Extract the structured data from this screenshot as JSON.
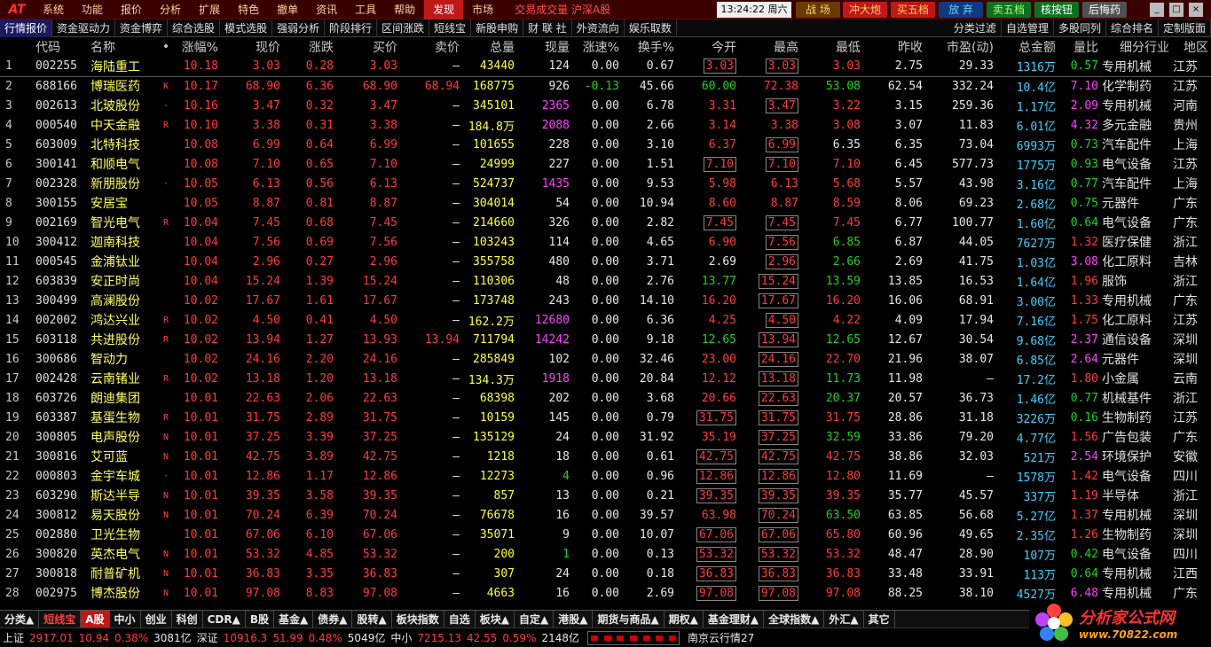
{
  "menubar": {
    "logo": "AT",
    "items": [
      "系统",
      "功能",
      "报价",
      "分析",
      "扩展",
      "特色",
      "撤单",
      "资讯",
      "工具",
      "帮助",
      "发现",
      "市场"
    ],
    "active_index": 10,
    "ticker": "交易成交量 沪深A股",
    "clock": "13:24:22 周六",
    "quick_buttons": [
      {
        "label": "战 场",
        "bg": "#6a3a00",
        "fg": "#ffd060"
      },
      {
        "label": "冲大炮",
        "bg": "#c01818",
        "fg": "#ffd060"
      },
      {
        "label": "买五档",
        "bg": "#c01818",
        "fg": "#ffd060"
      },
      {
        "label": "放 弃",
        "bg": "#103a80",
        "fg": "#60d0ff"
      },
      {
        "label": "卖五档",
        "bg": "#107020",
        "fg": "#a0ff80"
      },
      {
        "label": "核按钮",
        "bg": "#107020",
        "fg": "#ffffff"
      },
      {
        "label": "后悔药",
        "bg": "#505050",
        "fg": "#ffffff"
      }
    ],
    "window_buttons": [
      "_",
      "□",
      "×"
    ]
  },
  "subbar": {
    "items": [
      "行情报价",
      "资金驱动力",
      "资金博弈",
      "综合选股",
      "模式选股",
      "强弱分析",
      "阶段排行",
      "区间涨跌",
      "短线宝",
      "新股申购",
      "财 联 社",
      "外资流向",
      "娱乐取数"
    ],
    "active_index": 0,
    "right_items": [
      "分类过滤",
      "自选管理",
      "多股同列",
      "综合排名",
      "定制版面"
    ]
  },
  "table": {
    "columns": [
      "",
      "代码",
      "名称",
      "•",
      "涨幅%",
      "现价",
      "涨跌",
      "买价",
      "卖价",
      "总量",
      "现量",
      "涨速%",
      "换手%",
      "今开",
      "最高",
      "最低",
      "昨收",
      "市盈(动)",
      "总金额",
      "量比",
      "细分行业",
      "地区"
    ],
    "rows": [
      [
        "1",
        "002255",
        "海陆重工",
        "",
        "10.18",
        "3.03",
        "0.28",
        "3.03",
        "–",
        "43440",
        "124",
        "0.00",
        "0.67",
        "3.03",
        "3.03",
        "3.03",
        "2.75",
        "29.33",
        "1316万",
        "0.57",
        "专用机械",
        "江苏"
      ],
      [
        "2",
        "688166",
        "博瑞医药",
        "K",
        "10.17",
        "68.90",
        "6.36",
        "68.90",
        "68.94",
        "168775",
        "926",
        "-0.13",
        "45.66",
        "60.00",
        "72.38",
        "53.08",
        "62.54",
        "332.24",
        "10.4亿",
        "7.10",
        "化学制药",
        "江苏"
      ],
      [
        "3",
        "002613",
        "北玻股份",
        "·",
        "10.16",
        "3.47",
        "0.32",
        "3.47",
        "–",
        "345101",
        "2365",
        "0.00",
        "6.78",
        "3.31",
        "3.47",
        "3.22",
        "3.15",
        "259.36",
        "1.17亿",
        "2.09",
        "专用机械",
        "河南"
      ],
      [
        "4",
        "000540",
        "中天金融",
        "R",
        "10.10",
        "3.38",
        "0.31",
        "3.38",
        "–",
        "184.8万",
        "2088",
        "0.00",
        "2.66",
        "3.14",
        "3.38",
        "3.08",
        "3.07",
        "11.83",
        "6.01亿",
        "4.32",
        "多元金融",
        "贵州"
      ],
      [
        "5",
        "603009",
        "北特科技",
        "",
        "10.08",
        "6.99",
        "0.64",
        "6.99",
        "–",
        "101655",
        "228",
        "0.00",
        "3.10",
        "6.37",
        "6.99",
        "6.35",
        "6.35",
        "73.04",
        "6993万",
        "0.73",
        "汽车配件",
        "上海"
      ],
      [
        "6",
        "300141",
        "和顺电气",
        "",
        "10.08",
        "7.10",
        "0.65",
        "7.10",
        "–",
        "24999",
        "227",
        "0.00",
        "1.51",
        "7.10",
        "7.10",
        "7.10",
        "6.45",
        "577.73",
        "1775万",
        "0.93",
        "电气设备",
        "江苏"
      ],
      [
        "7",
        "002328",
        "新朋股份",
        "·",
        "10.05",
        "6.13",
        "0.56",
        "6.13",
        "–",
        "524737",
        "1435",
        "0.00",
        "9.53",
        "5.98",
        "6.13",
        "5.68",
        "5.57",
        "43.98",
        "3.16亿",
        "0.77",
        "汽车配件",
        "上海"
      ],
      [
        "8",
        "300155",
        "安居宝",
        "",
        "10.05",
        "8.87",
        "0.81",
        "8.87",
        "–",
        "304014",
        "54",
        "0.00",
        "10.94",
        "8.60",
        "8.87",
        "8.59",
        "8.06",
        "69.23",
        "2.68亿",
        "0.75",
        "元器件",
        "广东"
      ],
      [
        "9",
        "002169",
        "智光电气",
        "R",
        "10.04",
        "7.45",
        "0.68",
        "7.45",
        "–",
        "214660",
        "326",
        "0.00",
        "2.82",
        "7.45",
        "7.45",
        "7.45",
        "6.77",
        "100.77",
        "1.60亿",
        "0.64",
        "电气设备",
        "广东"
      ],
      [
        "10",
        "300412",
        "迦南科技",
        "",
        "10.04",
        "7.56",
        "0.69",
        "7.56",
        "–",
        "103243",
        "114",
        "0.00",
        "4.65",
        "6.90",
        "7.56",
        "6.85",
        "6.87",
        "44.05",
        "7627万",
        "1.32",
        "医疗保健",
        "浙江"
      ],
      [
        "11",
        "000545",
        "金浦钛业",
        "",
        "10.04",
        "2.96",
        "0.27",
        "2.96",
        "–",
        "355758",
        "480",
        "0.00",
        "3.71",
        "2.69",
        "2.96",
        "2.66",
        "2.69",
        "41.75",
        "1.03亿",
        "3.08",
        "化工原料",
        "吉林"
      ],
      [
        "12",
        "603839",
        "安正时尚",
        "",
        "10.04",
        "15.24",
        "1.39",
        "15.24",
        "–",
        "110306",
        "48",
        "0.00",
        "2.76",
        "13.77",
        "15.24",
        "13.59",
        "13.85",
        "16.53",
        "1.64亿",
        "1.96",
        "服饰",
        "浙江"
      ],
      [
        "13",
        "300499",
        "高澜股份",
        "",
        "10.02",
        "17.67",
        "1.61",
        "17.67",
        "–",
        "173748",
        "243",
        "0.00",
        "14.10",
        "16.20",
        "17.67",
        "16.20",
        "16.06",
        "68.91",
        "3.00亿",
        "1.33",
        "专用机械",
        "广东"
      ],
      [
        "14",
        "002002",
        "鸿达兴业",
        "R",
        "10.02",
        "4.50",
        "0.41",
        "4.50",
        "–",
        "162.2万",
        "12680",
        "0.00",
        "6.36",
        "4.25",
        "4.50",
        "4.22",
        "4.09",
        "17.94",
        "7.16亿",
        "1.75",
        "化工原料",
        "江苏"
      ],
      [
        "15",
        "603118",
        "共进股份",
        "R",
        "10.02",
        "13.94",
        "1.27",
        "13.93",
        "13.94",
        "711794",
        "14242",
        "0.00",
        "9.18",
        "12.65",
        "13.94",
        "12.65",
        "12.67",
        "30.54",
        "9.68亿",
        "2.37",
        "通信设备",
        "深圳"
      ],
      [
        "16",
        "300686",
        "智动力",
        "",
        "10.02",
        "24.16",
        "2.20",
        "24.16",
        "–",
        "285849",
        "102",
        "0.00",
        "32.46",
        "23.00",
        "24.16",
        "22.70",
        "21.96",
        "38.07",
        "6.85亿",
        "2.64",
        "元器件",
        "深圳"
      ],
      [
        "17",
        "002428",
        "云南锗业",
        "R",
        "10.02",
        "13.18",
        "1.20",
        "13.18",
        "–",
        "134.3万",
        "1918",
        "0.00",
        "20.84",
        "12.12",
        "13.18",
        "11.73",
        "11.98",
        "–",
        "17.2亿",
        "1.80",
        "小金属",
        "云南"
      ],
      [
        "18",
        "603726",
        "朗迪集团",
        "",
        "10.01",
        "22.63",
        "2.06",
        "22.63",
        "–",
        "68398",
        "202",
        "0.00",
        "3.68",
        "20.66",
        "22.63",
        "20.37",
        "20.57",
        "36.73",
        "1.46亿",
        "0.77",
        "机械基件",
        "浙江"
      ],
      [
        "19",
        "603387",
        "基蛋生物",
        "R",
        "10.01",
        "31.75",
        "2.89",
        "31.75",
        "–",
        "10159",
        "145",
        "0.00",
        "0.79",
        "31.75",
        "31.75",
        "31.75",
        "28.86",
        "31.18",
        "3226万",
        "0.16",
        "生物制药",
        "江苏"
      ],
      [
        "20",
        "300805",
        "电声股份",
        "N",
        "10.01",
        "37.25",
        "3.39",
        "37.25",
        "–",
        "135129",
        "24",
        "0.00",
        "31.92",
        "35.19",
        "37.25",
        "32.59",
        "33.86",
        "79.20",
        "4.77亿",
        "1.56",
        "广告包装",
        "广东"
      ],
      [
        "21",
        "300816",
        "艾可蓝",
        "N",
        "10.01",
        "42.75",
        "3.89",
        "42.75",
        "–",
        "1218",
        "18",
        "0.00",
        "0.61",
        "42.75",
        "42.75",
        "42.75",
        "38.86",
        "32.03",
        "521万",
        "2.54",
        "环境保护",
        "安徽"
      ],
      [
        "22",
        "000803",
        "金宇车城",
        "·",
        "10.01",
        "12.86",
        "1.17",
        "12.86",
        "–",
        "12273",
        "4",
        "0.00",
        "0.96",
        "12.86",
        "12.86",
        "12.80",
        "11.69",
        "–",
        "1578万",
        "1.42",
        "电气设备",
        "四川"
      ],
      [
        "23",
        "603290",
        "斯达半导",
        "N",
        "10.01",
        "39.35",
        "3.58",
        "39.35",
        "–",
        "857",
        "13",
        "0.00",
        "0.21",
        "39.35",
        "39.35",
        "39.35",
        "35.77",
        "45.57",
        "337万",
        "1.19",
        "半导体",
        "浙江"
      ],
      [
        "24",
        "300812",
        "易天股份",
        "N",
        "10.01",
        "70.24",
        "6.39",
        "70.24",
        "–",
        "76678",
        "16",
        "0.00",
        "39.57",
        "63.98",
        "70.24",
        "63.50",
        "63.85",
        "56.68",
        "5.27亿",
        "1.37",
        "专用机械",
        "深圳"
      ],
      [
        "25",
        "002880",
        "卫光生物",
        "",
        "10.01",
        "67.06",
        "6.10",
        "67.06",
        "–",
        "35071",
        "9",
        "0.00",
        "10.07",
        "67.06",
        "67.06",
        "65.80",
        "60.96",
        "49.65",
        "2.35亿",
        "1.26",
        "生物制药",
        "深圳"
      ],
      [
        "26",
        "300820",
        "英杰电气",
        "N",
        "10.01",
        "53.32",
        "4.85",
        "53.32",
        "–",
        "200",
        "1",
        "0.00",
        "0.13",
        "53.32",
        "53.32",
        "53.32",
        "48.47",
        "28.90",
        "107万",
        "0.42",
        "电气设备",
        "四川"
      ],
      [
        "27",
        "300818",
        "耐普矿机",
        "N",
        "10.01",
        "36.83",
        "3.35",
        "36.83",
        "–",
        "307",
        "24",
        "0.00",
        "0.18",
        "36.83",
        "36.83",
        "36.83",
        "33.48",
        "33.91",
        "113万",
        "0.64",
        "专用机械",
        "江西"
      ],
      [
        "28",
        "002975",
        "博杰股份",
        "N",
        "10.01",
        "97.08",
        "8.83",
        "97.08",
        "–",
        "4663",
        "16",
        "0.00",
        "2.69",
        "97.08",
        "97.08",
        "97.08",
        "88.25",
        "38.10",
        "4527万",
        "6.48",
        "专用机械",
        "广东"
      ]
    ],
    "boxed_cells": {
      "0": [
        13,
        14
      ],
      "1": [],
      "2": [
        14
      ],
      "3": [],
      "4": [
        14
      ],
      "5": [
        13,
        14
      ],
      "6": [],
      "7": [],
      "8": [
        13,
        14
      ],
      "9": [
        14
      ],
      "10": [
        14
      ],
      "11": [
        14
      ],
      "12": [
        14
      ],
      "13": [
        14
      ],
      "14": [
        14
      ],
      "15": [
        14
      ],
      "16": [
        14
      ],
      "17": [
        14
      ],
      "18": [
        13,
        14
      ],
      "19": [
        14
      ],
      "20": [
        13,
        14
      ],
      "21": [
        13,
        14
      ],
      "22": [
        13,
        14
      ],
      "23": [
        14
      ],
      "24": [
        13,
        14
      ],
      "25": [
        13,
        14
      ],
      "26": [
        13,
        14
      ],
      "27": [
        13,
        14
      ]
    }
  },
  "tabbar": {
    "items": [
      "分类▲",
      "短线宝",
      "A股",
      "中小",
      "创业",
      "科创",
      "CDR▲",
      "B股",
      "基金▲",
      "债券▲",
      "股转▲",
      "板块指数",
      "自选",
      "板块▲",
      "自定▲",
      "港股▲",
      "期货与商品▲",
      "期权▲",
      "基金理财▲",
      "全球指数▲",
      "外汇▲",
      "其它"
    ],
    "highlight_index": 1,
    "selected_index": 2
  },
  "statusbar": {
    "sh_label": "上证",
    "sh_value": "2917.01",
    "sh_change": "10.94",
    "sh_pct": "0.38%",
    "sh_amount": "3081亿",
    "sz_label": "深证",
    "sz_value": "10916.3",
    "sz_change": "51.99",
    "sz_pct": "0.48%",
    "sz_amount": "5049亿",
    "zx_label": "中小",
    "zx_value": "7215.13",
    "zx_change": "42.55",
    "zx_pct": "0.59%",
    "zx_amount": "2148亿",
    "server": "南京云行情27"
  },
  "brand": {
    "title": "分析家公式网",
    "url": "www.70822.com"
  },
  "colors": {
    "up": "#ff3b3b",
    "down": "#20d020",
    "name": "#ffff60",
    "volume": "#ffff40",
    "hand": "#ff40ff",
    "amount": "#40d0ff"
  }
}
